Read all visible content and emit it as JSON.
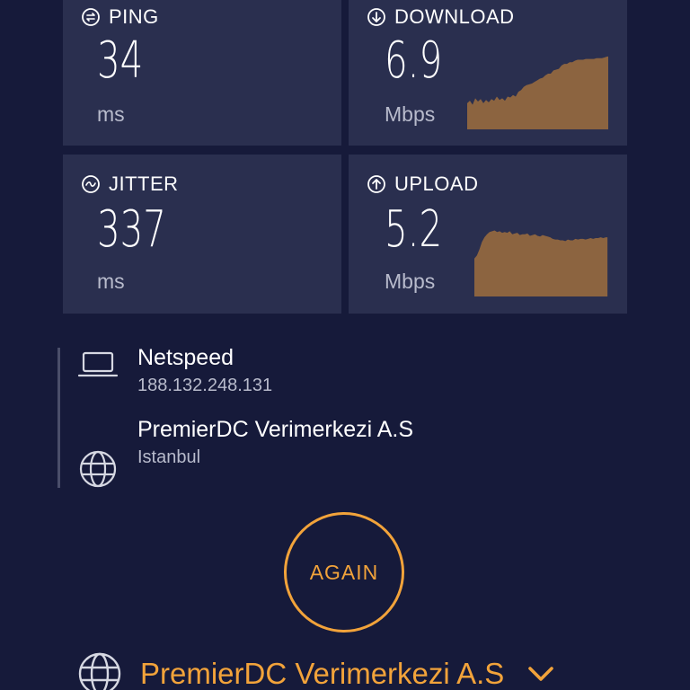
{
  "metrics": {
    "ping": {
      "label": "PING",
      "value": "34",
      "unit": "ms",
      "icon": "ping-icon"
    },
    "download": {
      "label": "DOWNLOAD",
      "value": "6.9",
      "unit": "Mbps",
      "icon": "download-arrow-icon"
    },
    "jitter": {
      "label": "JITTER",
      "value": "337",
      "unit": "ms",
      "icon": "jitter-wave-icon"
    },
    "upload": {
      "label": "UPLOAD",
      "value": "5.2",
      "unit": "Mbps",
      "icon": "upload-arrow-icon"
    }
  },
  "connection": {
    "provider": "Netspeed",
    "ip": "188.132.248.131",
    "provider_icon": "laptop-icon"
  },
  "server": {
    "name": "PremierDC Verimerkezi A.S",
    "location": "Istanbul",
    "icon": "globe-icon"
  },
  "again_label": "AGAIN",
  "server_selector": {
    "name": "PremierDC Verimerkezi A.S",
    "icon": "globe-icon",
    "dropdown_icon": "chevron-down-icon"
  },
  "colors": {
    "background": "#161a3a",
    "card": "#2a2f4f",
    "accent": "#f2a33a",
    "graph_fill": "#8c6440"
  }
}
